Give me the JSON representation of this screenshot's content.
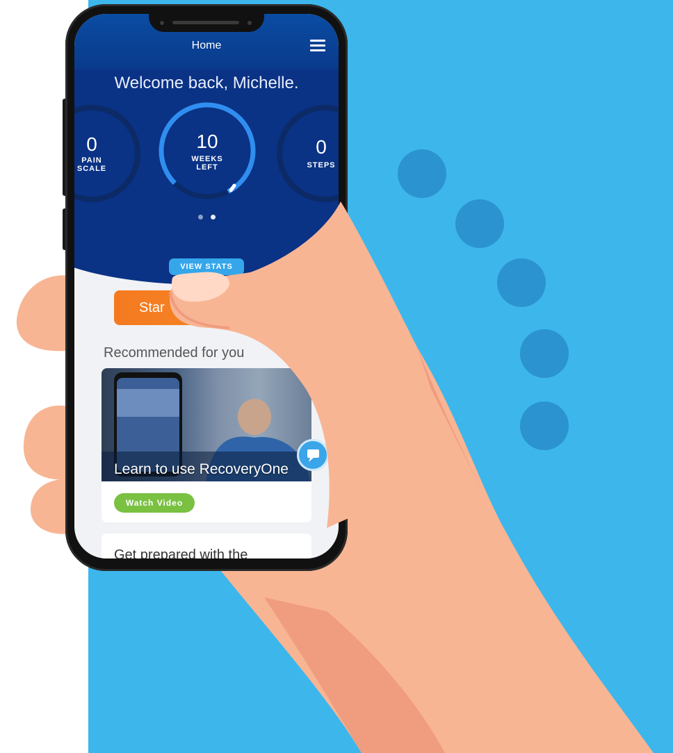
{
  "app": {
    "header_title": "Home",
    "welcome": "Welcome back, Michelle.",
    "stats": [
      {
        "value": "0",
        "label_line1": "PAIN",
        "label_line2": "SCALE"
      },
      {
        "value": "10",
        "label_line1": "WEEKS",
        "label_line2": "LEFT",
        "progress": 0.8
      },
      {
        "value": "0",
        "label_line1": "STEPS",
        "label_line2": ""
      }
    ],
    "view_stats": "VIEW STATS",
    "start_button": "Star",
    "recommended_heading": "Recommended for you",
    "card": {
      "title": "Learn to use RecoveryOne",
      "button": "Watch Video"
    },
    "card2_title": "Get prepared with the"
  },
  "colors": {
    "background": "#3db6ec",
    "header_blue": "#0a3285",
    "accent_blue": "#35a6ea",
    "orange": "#f57a1f",
    "green": "#7ac142",
    "skin": "#f8b594"
  }
}
